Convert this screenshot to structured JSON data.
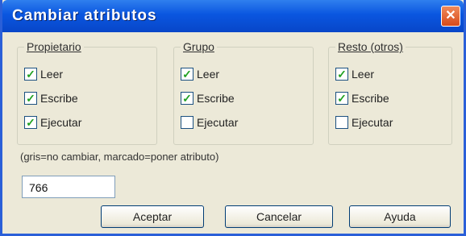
{
  "dialog": {
    "title": "Cambiar atributos",
    "close_glyph": "✕"
  },
  "groups": [
    {
      "label": "Propietario",
      "items": [
        {
          "label": "Leer",
          "checked": true
        },
        {
          "label": "Escribe",
          "checked": true
        },
        {
          "label": "Ejecutar",
          "checked": true
        }
      ]
    },
    {
      "label": "Grupo",
      "items": [
        {
          "label": "Leer",
          "checked": true
        },
        {
          "label": "Escribe",
          "checked": true
        },
        {
          "label": "Ejecutar",
          "checked": false
        }
      ]
    },
    {
      "label": "Resto (otros)",
      "items": [
        {
          "label": "Leer",
          "checked": true
        },
        {
          "label": "Escribe",
          "checked": true
        },
        {
          "label": "Ejecutar",
          "checked": false
        }
      ]
    }
  ],
  "hint": "(gris=no cambiar, marcado=poner atributo)",
  "mode_value": "766",
  "buttons": {
    "accept": "Aceptar",
    "cancel": "Cancelar",
    "help": "Ayuda"
  },
  "colors": {
    "title_bar": "#0a56e0",
    "window_bg": "#ece9d8",
    "check_mark": "#21a121"
  }
}
